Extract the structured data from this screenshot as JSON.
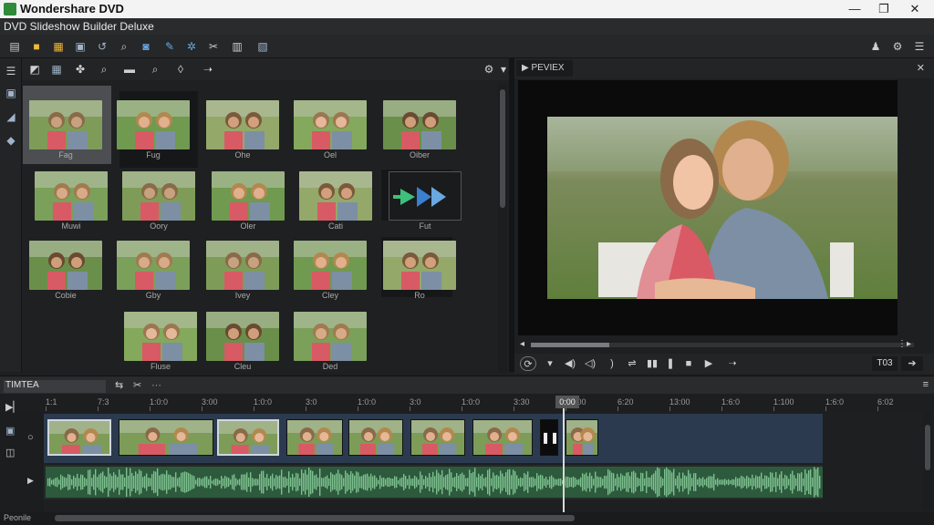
{
  "window": {
    "app_title": "Wondershare DVD",
    "subtitle": "DVD Slideshow Builder Deluxe",
    "min": "—",
    "max": "❐",
    "close": "✕"
  },
  "library": {
    "items": [
      {
        "caption": "Fag"
      },
      {
        "caption": "Fug"
      },
      {
        "caption": "Ohe"
      },
      {
        "caption": "Oel"
      },
      {
        "caption": "Oiber"
      },
      {
        "caption": "Muwi"
      },
      {
        "caption": "Oory"
      },
      {
        "caption": "Oler"
      },
      {
        "caption": "Cati"
      },
      {
        "caption": "Fut"
      },
      {
        "caption": "Cobie"
      },
      {
        "caption": "Gby"
      },
      {
        "caption": "Ivey"
      },
      {
        "caption": "Cley"
      },
      {
        "caption": "Ro"
      },
      {
        "caption": "Fluse"
      },
      {
        "caption": "Cleu"
      },
      {
        "caption": "Ded"
      }
    ]
  },
  "preview": {
    "tab_label": "PEVIEX",
    "close": "✕"
  },
  "controls": {
    "time_display": "T03"
  },
  "timeline": {
    "label": "TIMTEA",
    "ticks": [
      "1:1",
      "7:3",
      "1:0:0",
      "3:00",
      "1:0:0",
      "3:0",
      "1:0:0",
      "3:0",
      "1:0:0",
      "3:30",
      "1:000",
      "6:20",
      "13:00",
      "1:6:0",
      "1:100",
      "1:6:0",
      "6:02"
    ],
    "playhead_label": "0:00",
    "bottom_label": "Peonile"
  },
  "colors": {
    "audio_wave": "#7dc08f",
    "video_track": "#2b3a4e",
    "accent": "#3aa0e0"
  }
}
